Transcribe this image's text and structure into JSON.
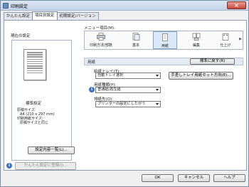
{
  "window": {
    "title": "印刷設定",
    "close_label": "×"
  },
  "tabs": [
    {
      "label": "かんたん設定"
    },
    {
      "label": "項目別設定"
    },
    {
      "label": "初期設定/バージョン"
    }
  ],
  "preview": {
    "label": "現在の設定",
    "settings_title": "標準設定",
    "lines": [
      "原稿サイズ:",
      "A4 (210 x 297 mm)",
      "印刷用紙サイズ:",
      "原稿サイズと同じ"
    ],
    "details_button": "設定内容一覧(L)...",
    "register_button": "かんたん設定に登録(I)..."
  },
  "menu": {
    "label": "メニュー項目(M):",
    "items": [
      {
        "label": "印刷方法/部数",
        "icon": "printer-icon"
      },
      {
        "label": "基本",
        "icon": "document-icon"
      },
      {
        "label": "用紙",
        "icon": "paper-icon"
      },
      {
        "label": "編集",
        "icon": "edit-icon"
      },
      {
        "label": "仕上げ",
        "icon": "finishing-icon"
      }
    ],
    "scroll_arrow": "▶"
  },
  "section": {
    "title": "用紙",
    "default_button": "標準に戻す(R)"
  },
  "fields": {
    "input_tray": {
      "label": "給紙トレイ(T):",
      "value": "自動トレイ選択"
    },
    "paper_type": {
      "label": "用紙種類(P):",
      "value": "普通紙/再生紙"
    },
    "output_tray": {
      "label": "排紙先(O):",
      "value": "プリンターの設定にしたがう"
    },
    "bypass_button": "手差しトレイ用紙セット方向(E)..."
  },
  "footer": {
    "ok": "OK",
    "cancel": "キャンセル",
    "help": "ヘルプ"
  }
}
